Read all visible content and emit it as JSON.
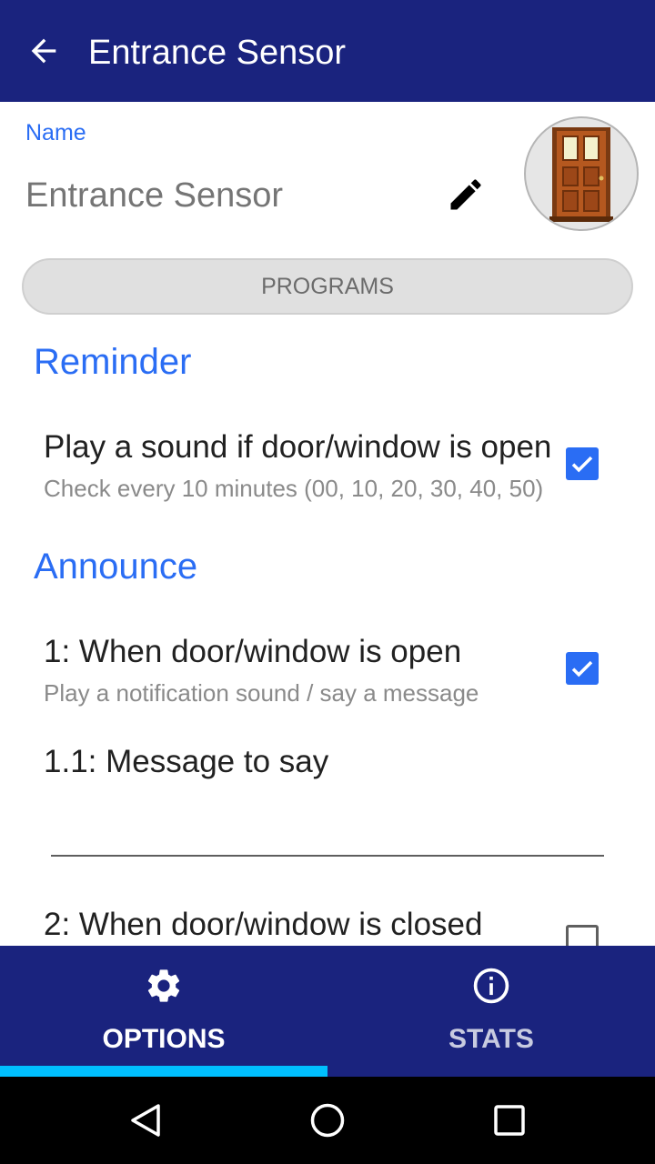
{
  "appbar": {
    "title": "Entrance Sensor"
  },
  "name_field": {
    "label": "Name",
    "value": "Entrance Sensor"
  },
  "programs_button": "PROGRAMS",
  "sections": {
    "reminder": {
      "title": "Reminder",
      "item": {
        "title": "Play a sound if door/window is open",
        "subtitle": "Check every 10 minutes (00, 10, 20, 30, 40, 50)",
        "checked": true
      }
    },
    "announce": {
      "title": "Announce",
      "item1": {
        "title": "1: When door/window is open",
        "subtitle": "Play a notification sound / say a message",
        "checked": true
      },
      "message": {
        "title": "1.1: Message to say",
        "value": ""
      },
      "item2": {
        "title": "2: When door/window is closed",
        "checked": false
      }
    }
  },
  "bottom_nav": {
    "tabs": [
      {
        "label": "OPTIONS",
        "icon": "gear-icon",
        "selected": true
      },
      {
        "label": "STATS",
        "icon": "info-icon",
        "selected": false
      }
    ]
  },
  "colors": {
    "primary": "#1a237e",
    "accent": "#2a6df4",
    "indicator": "#00bfff"
  }
}
